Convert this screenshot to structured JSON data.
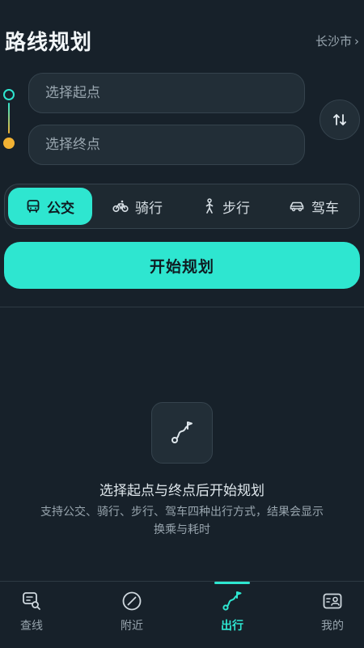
{
  "header": {
    "title": "路线规划",
    "city": "长沙市",
    "city_chevron": "›"
  },
  "inputs": {
    "start_placeholder": "选择起点",
    "end_placeholder": "选择终点"
  },
  "swap": {
    "icon": "swap-vertical-icon"
  },
  "modes": [
    {
      "label": "公交",
      "icon": "bus-icon",
      "active": true
    },
    {
      "label": "骑行",
      "icon": "bicycle-icon",
      "active": false
    },
    {
      "label": "步行",
      "icon": "walk-icon",
      "active": false
    },
    {
      "label": "驾车",
      "icon": "car-icon",
      "active": false
    }
  ],
  "start_button": {
    "label": "开始规划"
  },
  "empty_state": {
    "icon": "route-icon",
    "title": "选择起点与终点后开始规划",
    "description": "支持公交、骑行、步行、驾车四种出行方式，结果会显示换乘与耗时"
  },
  "nav": [
    {
      "label": "查线",
      "icon": "search-line-icon",
      "active": false
    },
    {
      "label": "附近",
      "icon": "compass-icon",
      "active": false
    },
    {
      "label": "出行",
      "icon": "route-icon",
      "active": true
    },
    {
      "label": "我的",
      "icon": "profile-card-icon",
      "active": false
    }
  ],
  "colors": {
    "background": "#17212a",
    "accent": "#2ee6d0",
    "start_dot": "#2ee6d0",
    "end_dot": "#f2b233",
    "surface": "#222e37",
    "muted_text": "#98a5ae"
  }
}
